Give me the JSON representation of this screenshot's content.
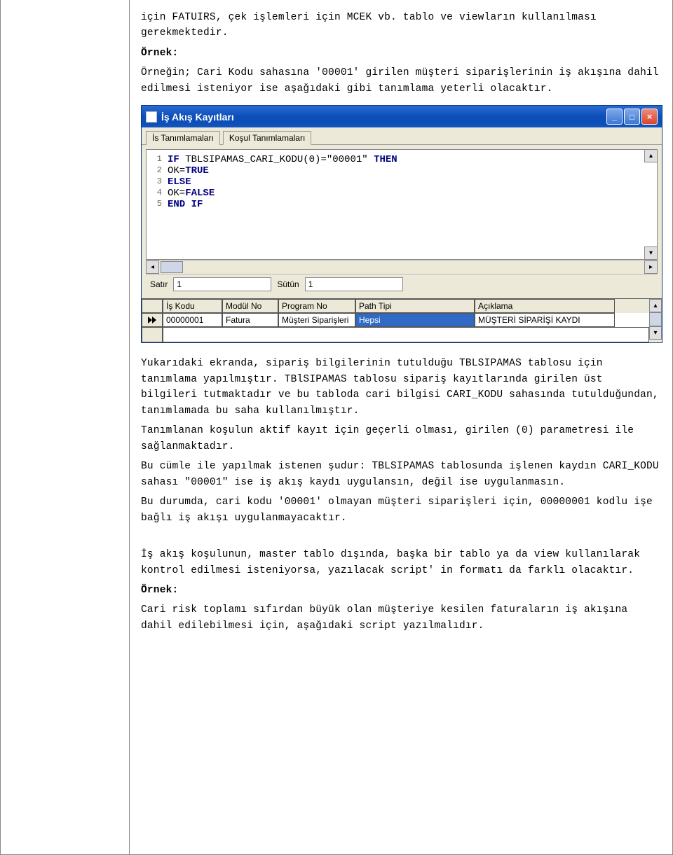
{
  "para1": "için FATUIRS, çek işlemleri için MCEK vb. tablo ve viewların kullanılması gerekmektedir.",
  "ornek_label": "Örnek:",
  "para2": "Örneğin; Cari Kodu sahasına '00001' girilen müşteri siparişlerinin iş akışına dahil edilmesi isteniyor ise aşağıdaki gibi tanımlama yeterli olacaktır.",
  "window": {
    "title": "İş Akış Kayıtları",
    "tabs": [
      {
        "label": "İs Tanımlamaları",
        "active": false
      },
      {
        "label": "Koşul Tanımlamaları",
        "active": true
      }
    ],
    "code": {
      "lines": [
        {
          "n": "1",
          "content": [
            {
              "t": "kw",
              "v": "IF "
            },
            {
              "t": "txt",
              "v": "TBLSIPAMAS_CARI_KODU(0)=\"00001\" "
            },
            {
              "t": "kw",
              "v": "THEN"
            }
          ]
        },
        {
          "n": "2",
          "content": [
            {
              "t": "txt",
              "v": "OK="
            },
            {
              "t": "kw",
              "v": "TRUE"
            }
          ]
        },
        {
          "n": "3",
          "content": [
            {
              "t": "kw",
              "v": "ELSE"
            }
          ]
        },
        {
          "n": "4",
          "content": [
            {
              "t": "txt",
              "v": "OK="
            },
            {
              "t": "kw",
              "v": "FALSE"
            }
          ]
        },
        {
          "n": "5",
          "content": [
            {
              "t": "kw",
              "v": "END IF"
            }
          ]
        }
      ]
    },
    "status": {
      "satir_label": "Satır",
      "satir_val": "1",
      "sutun_label": "Sütün",
      "sutun_val": "1"
    },
    "grid": {
      "headers": [
        "İş Kodu",
        "Modül No",
        "Program No",
        "Path Tipi",
        "Açıklama"
      ],
      "row": {
        "is": "00000001",
        "mod": "Fatura",
        "prog": "Müşteri Siparişleri",
        "path": "Hepsi",
        "acik": "MÜŞTERİ SİPARİŞİ KAYDI"
      }
    }
  },
  "para3": "Yukarıdaki ekranda, sipariş bilgilerinin tutulduğu TBLSIPAMAS tablosu için tanımlama yapılmıştır. TBlSIPAMAS tablosu sipariş kayıtlarında girilen üst bilgileri tutmaktadır ve bu tabloda cari bilgisi CARI_KODU sahasında tutulduğundan, tanımlamada bu saha kullanılmıştır.",
  "para4": "Tanımlanan koşulun aktif kayıt için geçerli olması, girilen (0) parametresi ile sağlanmaktadır.",
  "para5": "Bu cümle ile yapılmak istenen şudur: TBLSIPAMAS tablosunda işlenen kaydın CARI_KODU sahası \"00001\" ise iş akış kaydı uygulansın, değil ise uygulanmasın.",
  "para6": "Bu durumda, cari kodu '00001' olmayan müşteri siparişleri için, 00000001 kodlu işe bağlı iş akışı uygulanmayacaktır.",
  "para7": "İş akış koşulunun, master tablo dışında, başka bir tablo ya da view kullanılarak kontrol edilmesi isteniyorsa, yazılacak script' in formatı da farklı olacaktır.",
  "para8": "Cari risk toplamı sıfırdan büyük olan müşteriye kesilen faturaların iş akışına dahil edilebilmesi için, aşağıdaki script yazılmalıdır."
}
